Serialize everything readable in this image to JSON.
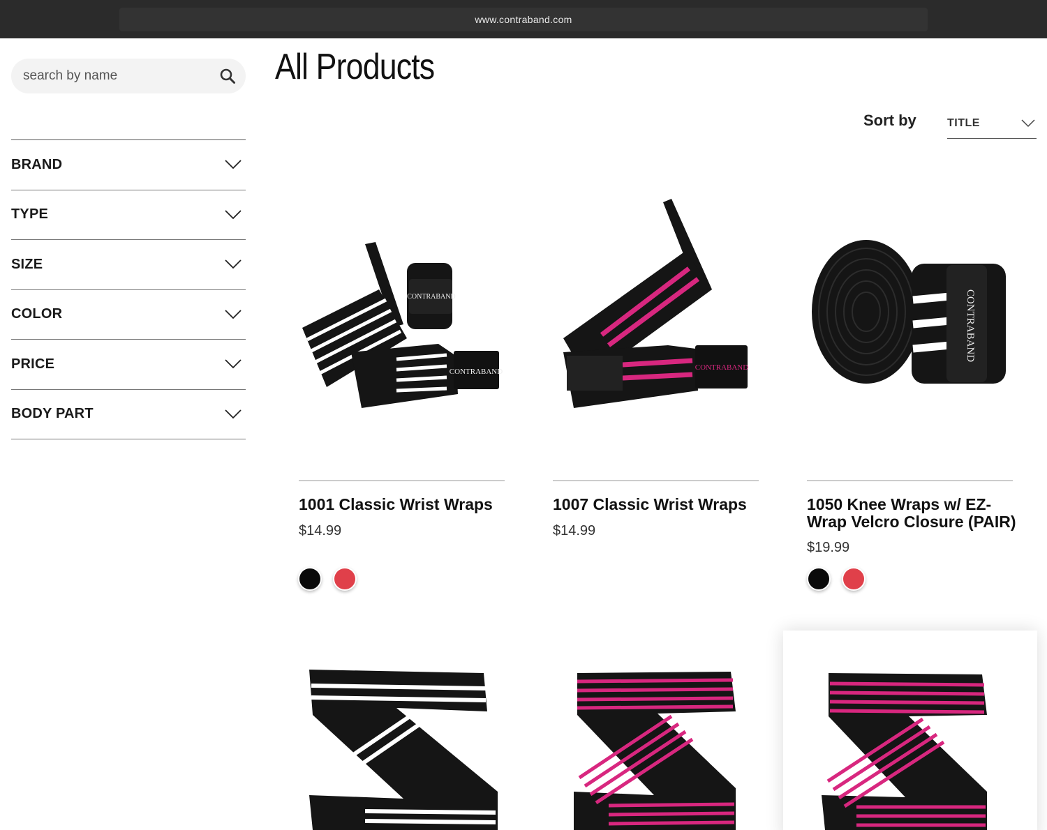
{
  "browser": {
    "url": "www.contraband.com"
  },
  "search": {
    "placeholder": "search by name"
  },
  "filters": [
    "BRAND",
    "TYPE",
    "SIZE",
    "COLOR",
    "PRICE",
    "BODY PART"
  ],
  "page": {
    "title": "All Products"
  },
  "sort": {
    "label": "Sort by",
    "value": "TITLE"
  },
  "products": [
    {
      "name": "1001 Classic Wrist Wraps",
      "price": "$14.99",
      "swatches": [
        "#0a0a0a",
        "#e0404a"
      ]
    },
    {
      "name": "1007 Classic Wrist Wraps",
      "price": "$14.99",
      "swatches": []
    },
    {
      "name": "1050 Knee Wraps w/ EZ-Wrap Velcro Closure (PAIR)",
      "price": "$19.99",
      "swatches": [
        "#0a0a0a",
        "#e0404a"
      ]
    }
  ],
  "colors": {
    "accent_pink": "#d8277f",
    "wrap_black": "#151515",
    "stripe_white": "#ffffff",
    "swatch_red": "#e0404a"
  }
}
